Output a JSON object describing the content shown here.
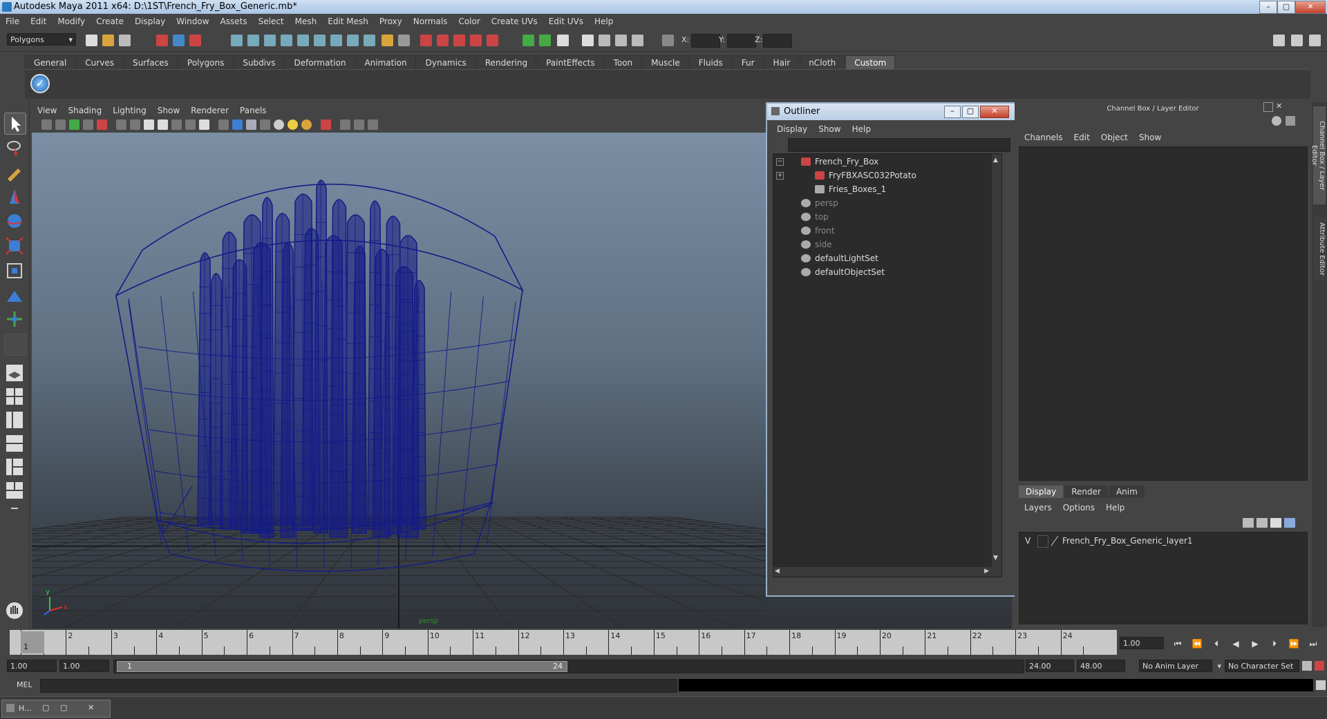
{
  "window": {
    "title": "Autodesk Maya 2011 x64: D:\\1ST\\French_Fry_Box_Generic.mb*",
    "min": "–",
    "max": "▢",
    "close": "✕"
  },
  "menubar": [
    "File",
    "Edit",
    "Modify",
    "Create",
    "Display",
    "Window",
    "Assets",
    "Select",
    "Mesh",
    "Edit Mesh",
    "Proxy",
    "Normals",
    "Color",
    "Create UVs",
    "Edit UVs",
    "Help"
  ],
  "statusline": {
    "mode": "Polygons",
    "x_label": "X:",
    "y_label": "Y:",
    "z_label": "Z:"
  },
  "shelf": {
    "tabs": [
      "General",
      "Curves",
      "Surfaces",
      "Polygons",
      "Subdivs",
      "Deformation",
      "Animation",
      "Dynamics",
      "Rendering",
      "PaintEffects",
      "Toon",
      "Muscle",
      "Fluids",
      "Fur",
      "Hair",
      "nCloth",
      "Custom"
    ],
    "active": "Custom"
  },
  "viewport": {
    "menu": [
      "View",
      "Shading",
      "Lighting",
      "Show",
      "Renderer",
      "Panels"
    ],
    "camera_label": "persp",
    "axis": {
      "x": "x",
      "y": "y",
      "z": "z"
    },
    "wire_color": "#141c86"
  },
  "outliner": {
    "title": "Outliner",
    "menu": [
      "Display",
      "Show",
      "Help"
    ],
    "nodes": [
      {
        "label": "French_Fry_Box",
        "indent": 0,
        "kind": "transform",
        "expand": "−"
      },
      {
        "label": "FryFBXASC032Potato",
        "indent": 1,
        "kind": "transform",
        "expand": "+"
      },
      {
        "label": "Fries_Boxes_1",
        "indent": 1,
        "kind": "group",
        "expand": ""
      },
      {
        "label": "persp",
        "indent": 0,
        "kind": "camera",
        "expand": "",
        "dim": true
      },
      {
        "label": "top",
        "indent": 0,
        "kind": "camera",
        "expand": "",
        "dim": true
      },
      {
        "label": "front",
        "indent": 0,
        "kind": "camera",
        "expand": "",
        "dim": true
      },
      {
        "label": "side",
        "indent": 0,
        "kind": "camera",
        "expand": "",
        "dim": true
      },
      {
        "label": "defaultLightSet",
        "indent": 0,
        "kind": "set",
        "expand": ""
      },
      {
        "label": "defaultObjectSet",
        "indent": 0,
        "kind": "set",
        "expand": ""
      }
    ]
  },
  "channelbox": {
    "title": "Channel Box / Layer Editor",
    "menu": [
      "Channels",
      "Edit",
      "Object",
      "Show"
    ],
    "layer_tabs": [
      "Display",
      "Render",
      "Anim"
    ],
    "active_layer_tab": "Display",
    "layer_menu": [
      "Layers",
      "Options",
      "Help"
    ],
    "layers": [
      {
        "visible": "V",
        "name": "French_Fry_Box_Generic_layer1"
      }
    ]
  },
  "side_tabs": [
    "Channel Box / Layer Editor",
    "Attribute Editor"
  ],
  "timeline": {
    "ticks": [
      "1",
      "2",
      "3",
      "4",
      "5",
      "6",
      "7",
      "8",
      "9",
      "10",
      "11",
      "12",
      "13",
      "14",
      "15",
      "16",
      "17",
      "18",
      "19",
      "20",
      "21",
      "22",
      "23",
      "24"
    ],
    "current_time": "1.00",
    "current_frame_marker": "1"
  },
  "range": {
    "start": "1.00",
    "playback_start": "1.00",
    "slider_start": "1",
    "slider_end": "24",
    "playback_end": "24.00",
    "end": "48.00",
    "anim_layer": "No Anim Layer",
    "character_set": "No Character Set"
  },
  "cmdline": {
    "label": "MEL"
  },
  "taskbar": {
    "label": "H..."
  }
}
